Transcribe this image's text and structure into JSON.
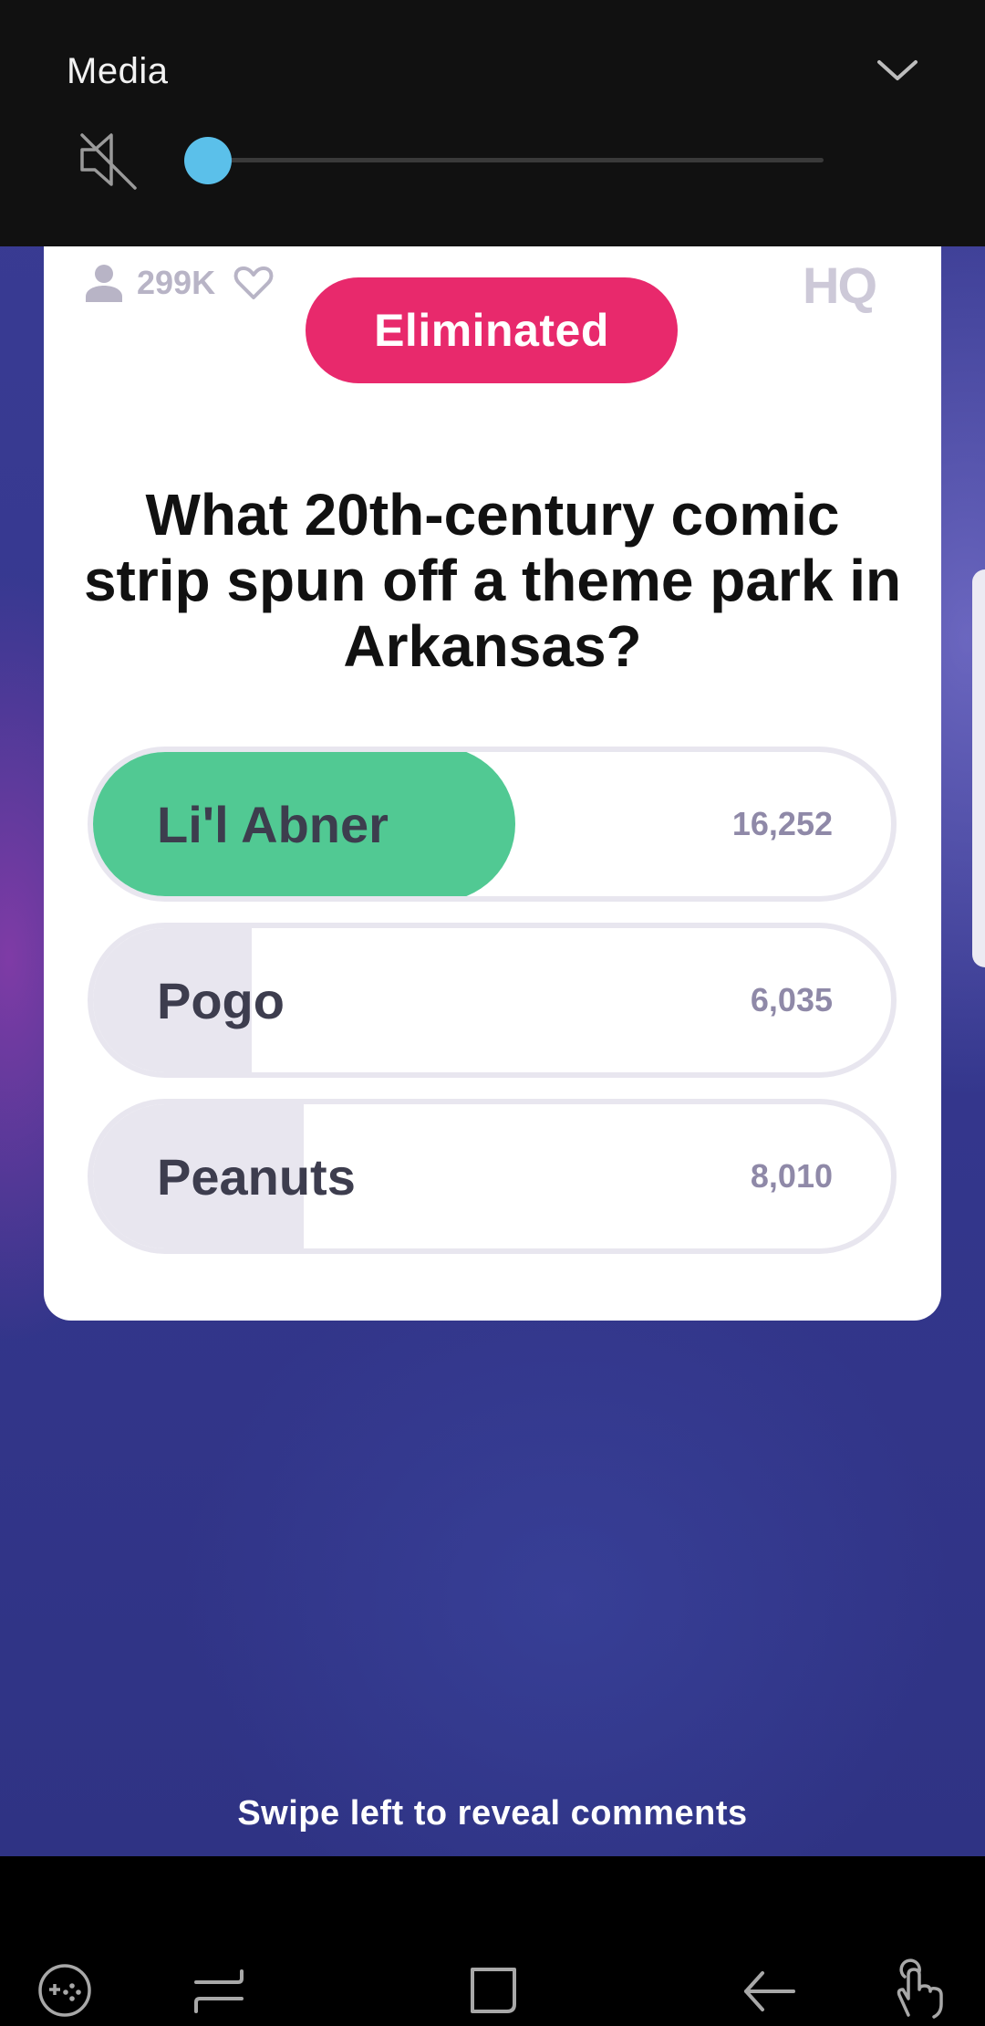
{
  "media_panel": {
    "title": "Media",
    "volume_level": 0
  },
  "stats": {
    "viewer_count": "299K"
  },
  "logo_text": "HQ",
  "status_badge": "Eliminated",
  "question": "What 20th-century comic strip spun off a theme park in Arkansas?",
  "answers": [
    {
      "label": "Li'l Abner",
      "votes": "16,252",
      "correct": true
    },
    {
      "label": "Pogo",
      "votes": "6,035",
      "correct": false
    },
    {
      "label": "Peanuts",
      "votes": "8,010",
      "correct": false
    }
  ],
  "hint": "Swipe left to reveal comments",
  "colors": {
    "eliminated": "#e8296c",
    "correct": "#51c993",
    "slider": "#5bc0ea"
  },
  "nav_icons": [
    "game-tools-icon",
    "recents-icon",
    "home-icon",
    "back-icon",
    "gesture-icon"
  ]
}
